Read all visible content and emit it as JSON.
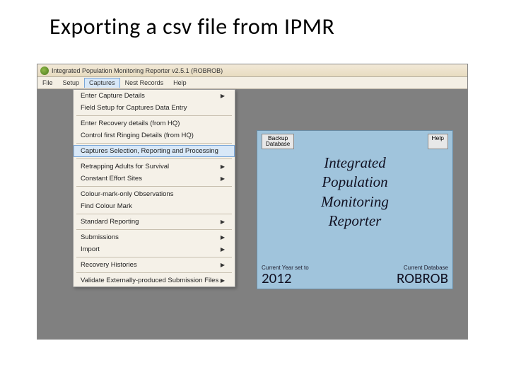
{
  "slide": {
    "title": "Exporting a csv file from IPMR"
  },
  "window": {
    "title": "Integrated Population Monitoring Reporter v2.5.1 (ROBROB)"
  },
  "menubar": {
    "items": [
      "File",
      "Setup",
      "Captures",
      "Nest Records",
      "Help"
    ],
    "open_index": 2
  },
  "dropdown": {
    "groups": [
      [
        {
          "label": "Enter Capture Details",
          "submenu": true
        },
        {
          "label": "Field Setup for Captures Data Entry",
          "submenu": false
        }
      ],
      [
        {
          "label": "Enter Recovery details (from HQ)",
          "submenu": false
        },
        {
          "label": "Control first Ringing Details (from HQ)",
          "submenu": false
        }
      ],
      [
        {
          "label": "Captures Selection, Reporting and Processing",
          "submenu": false,
          "highlight": true
        }
      ],
      [
        {
          "label": "Retrapping Adults for Survival",
          "submenu": true
        },
        {
          "label": "Constant Effort Sites",
          "submenu": true
        }
      ],
      [
        {
          "label": "Colour-mark-only Observations",
          "submenu": false
        },
        {
          "label": "Find Colour Mark",
          "submenu": false
        }
      ],
      [
        {
          "label": "Standard Reporting",
          "submenu": true
        }
      ],
      [
        {
          "label": "Submissions",
          "submenu": true
        },
        {
          "label": "Import",
          "submenu": true
        }
      ],
      [
        {
          "label": "Recovery Histories",
          "submenu": true
        }
      ],
      [
        {
          "label": "Validate Externally-produced Submission Files",
          "submenu": true
        }
      ]
    ]
  },
  "home": {
    "backup_top": "Backup",
    "backup_bottom": "Database",
    "help": "Help",
    "title_l1": "Integrated",
    "title_l2": "Population",
    "title_l3": "Monitoring",
    "title_l4": "Reporter",
    "year_label": "Current Year set to",
    "year_value": "2012",
    "db_label": "Current Database",
    "db_value": "ROBROB"
  }
}
